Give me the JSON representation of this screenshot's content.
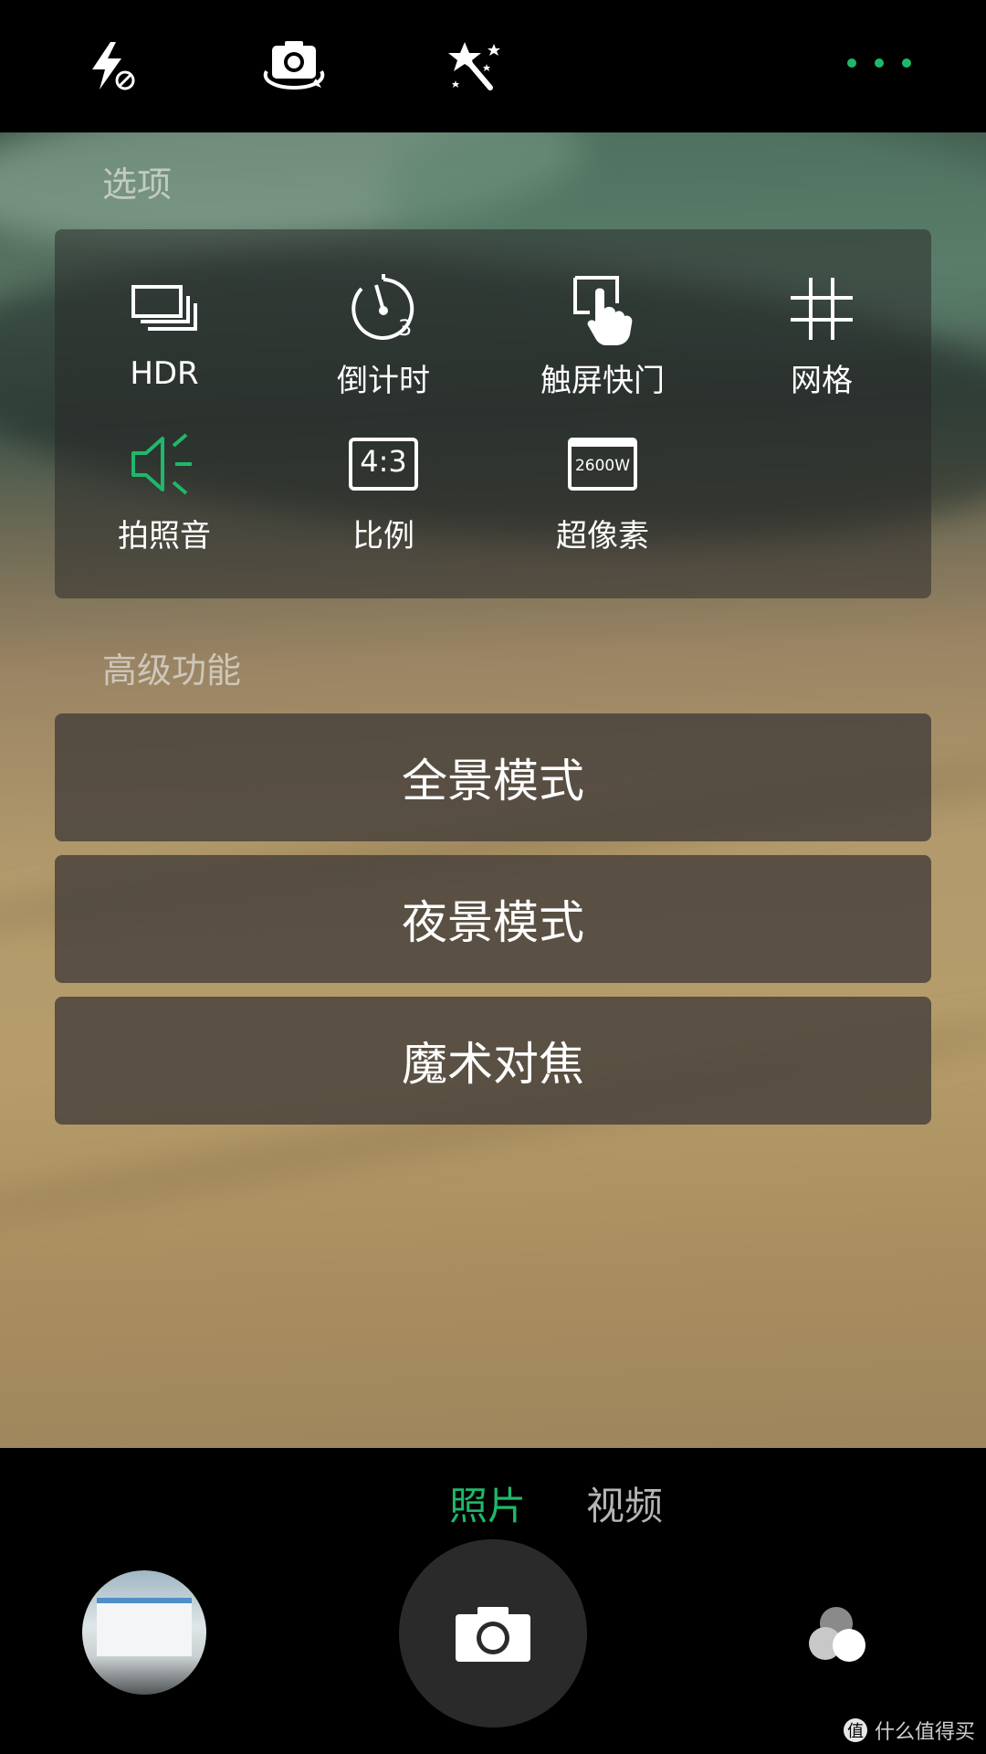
{
  "top_bar": {
    "icons": [
      "flash-off-icon",
      "switch-camera-icon",
      "magic-wand-icon",
      "more-options-icon"
    ]
  },
  "options": {
    "section_title": "选项",
    "items": [
      {
        "label": "HDR",
        "icon": "hdr-icon"
      },
      {
        "label": "倒计时",
        "icon": "timer-icon",
        "badge": "3"
      },
      {
        "label": "触屏快门",
        "icon": "touch-shutter-icon"
      },
      {
        "label": "网格",
        "icon": "grid-icon"
      },
      {
        "label": "拍照音",
        "icon": "shutter-sound-icon",
        "active": true
      },
      {
        "label": "比例",
        "icon": "ratio-icon",
        "badge": "4:3"
      },
      {
        "label": "超像素",
        "icon": "super-pixel-icon",
        "badge": "2600W"
      }
    ]
  },
  "advanced": {
    "section_title": "高级功能",
    "buttons": [
      "全景模式",
      "夜景模式",
      "魔术对焦"
    ]
  },
  "bottom": {
    "modes": [
      {
        "label": "照片",
        "active": true
      },
      {
        "label": "视频",
        "active": false
      }
    ],
    "watermark": "什么值得买",
    "watermark_badge": "值"
  },
  "colors": {
    "accent": "#1fb86a",
    "panel": "rgba(40,40,40,0.52)",
    "button": "rgba(70,64,58,0.82)"
  }
}
